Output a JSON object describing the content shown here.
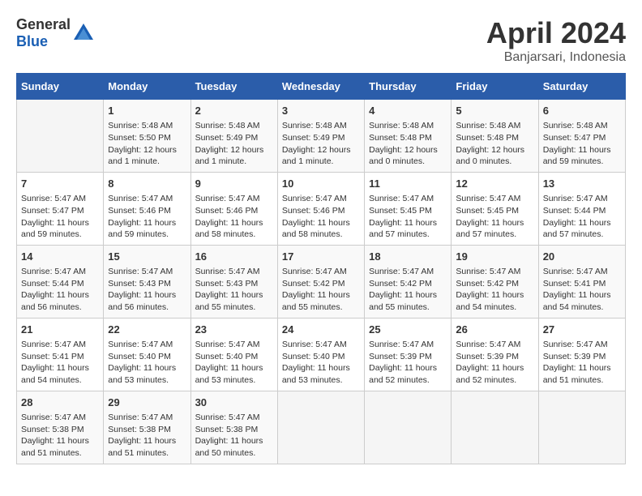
{
  "header": {
    "logo_general": "General",
    "logo_blue": "Blue",
    "month": "April 2024",
    "location": "Banjarsari, Indonesia"
  },
  "weekdays": [
    "Sunday",
    "Monday",
    "Tuesday",
    "Wednesday",
    "Thursday",
    "Friday",
    "Saturday"
  ],
  "weeks": [
    [
      {
        "day": "",
        "empty": true
      },
      {
        "day": "1",
        "sunrise": "5:48 AM",
        "sunset": "5:50 PM",
        "daylight": "12 hours and 1 minute."
      },
      {
        "day": "2",
        "sunrise": "5:48 AM",
        "sunset": "5:49 PM",
        "daylight": "12 hours and 1 minute."
      },
      {
        "day": "3",
        "sunrise": "5:48 AM",
        "sunset": "5:49 PM",
        "daylight": "12 hours and 1 minute."
      },
      {
        "day": "4",
        "sunrise": "5:48 AM",
        "sunset": "5:48 PM",
        "daylight": "12 hours and 0 minutes."
      },
      {
        "day": "5",
        "sunrise": "5:48 AM",
        "sunset": "5:48 PM",
        "daylight": "12 hours and 0 minutes."
      },
      {
        "day": "6",
        "sunrise": "5:48 AM",
        "sunset": "5:47 PM",
        "daylight": "11 hours and 59 minutes."
      }
    ],
    [
      {
        "day": "7",
        "sunrise": "5:47 AM",
        "sunset": "5:47 PM",
        "daylight": "11 hours and 59 minutes."
      },
      {
        "day": "8",
        "sunrise": "5:47 AM",
        "sunset": "5:46 PM",
        "daylight": "11 hours and 59 minutes."
      },
      {
        "day": "9",
        "sunrise": "5:47 AM",
        "sunset": "5:46 PM",
        "daylight": "11 hours and 58 minutes."
      },
      {
        "day": "10",
        "sunrise": "5:47 AM",
        "sunset": "5:46 PM",
        "daylight": "11 hours and 58 minutes."
      },
      {
        "day": "11",
        "sunrise": "5:47 AM",
        "sunset": "5:45 PM",
        "daylight": "11 hours and 57 minutes."
      },
      {
        "day": "12",
        "sunrise": "5:47 AM",
        "sunset": "5:45 PM",
        "daylight": "11 hours and 57 minutes."
      },
      {
        "day": "13",
        "sunrise": "5:47 AM",
        "sunset": "5:44 PM",
        "daylight": "11 hours and 57 minutes."
      }
    ],
    [
      {
        "day": "14",
        "sunrise": "5:47 AM",
        "sunset": "5:44 PM",
        "daylight": "11 hours and 56 minutes."
      },
      {
        "day": "15",
        "sunrise": "5:47 AM",
        "sunset": "5:43 PM",
        "daylight": "11 hours and 56 minutes."
      },
      {
        "day": "16",
        "sunrise": "5:47 AM",
        "sunset": "5:43 PM",
        "daylight": "11 hours and 55 minutes."
      },
      {
        "day": "17",
        "sunrise": "5:47 AM",
        "sunset": "5:42 PM",
        "daylight": "11 hours and 55 minutes."
      },
      {
        "day": "18",
        "sunrise": "5:47 AM",
        "sunset": "5:42 PM",
        "daylight": "11 hours and 55 minutes."
      },
      {
        "day": "19",
        "sunrise": "5:47 AM",
        "sunset": "5:42 PM",
        "daylight": "11 hours and 54 minutes."
      },
      {
        "day": "20",
        "sunrise": "5:47 AM",
        "sunset": "5:41 PM",
        "daylight": "11 hours and 54 minutes."
      }
    ],
    [
      {
        "day": "21",
        "sunrise": "5:47 AM",
        "sunset": "5:41 PM",
        "daylight": "11 hours and 54 minutes."
      },
      {
        "day": "22",
        "sunrise": "5:47 AM",
        "sunset": "5:40 PM",
        "daylight": "11 hours and 53 minutes."
      },
      {
        "day": "23",
        "sunrise": "5:47 AM",
        "sunset": "5:40 PM",
        "daylight": "11 hours and 53 minutes."
      },
      {
        "day": "24",
        "sunrise": "5:47 AM",
        "sunset": "5:40 PM",
        "daylight": "11 hours and 53 minutes."
      },
      {
        "day": "25",
        "sunrise": "5:47 AM",
        "sunset": "5:39 PM",
        "daylight": "11 hours and 52 minutes."
      },
      {
        "day": "26",
        "sunrise": "5:47 AM",
        "sunset": "5:39 PM",
        "daylight": "11 hours and 52 minutes."
      },
      {
        "day": "27",
        "sunrise": "5:47 AM",
        "sunset": "5:39 PM",
        "daylight": "11 hours and 51 minutes."
      }
    ],
    [
      {
        "day": "28",
        "sunrise": "5:47 AM",
        "sunset": "5:38 PM",
        "daylight": "11 hours and 51 minutes."
      },
      {
        "day": "29",
        "sunrise": "5:47 AM",
        "sunset": "5:38 PM",
        "daylight": "11 hours and 51 minutes."
      },
      {
        "day": "30",
        "sunrise": "5:47 AM",
        "sunset": "5:38 PM",
        "daylight": "11 hours and 50 minutes."
      },
      {
        "day": "",
        "empty": true
      },
      {
        "day": "",
        "empty": true
      },
      {
        "day": "",
        "empty": true
      },
      {
        "day": "",
        "empty": true
      }
    ]
  ],
  "labels": {
    "sunrise": "Sunrise:",
    "sunset": "Sunset:",
    "daylight": "Daylight:"
  }
}
